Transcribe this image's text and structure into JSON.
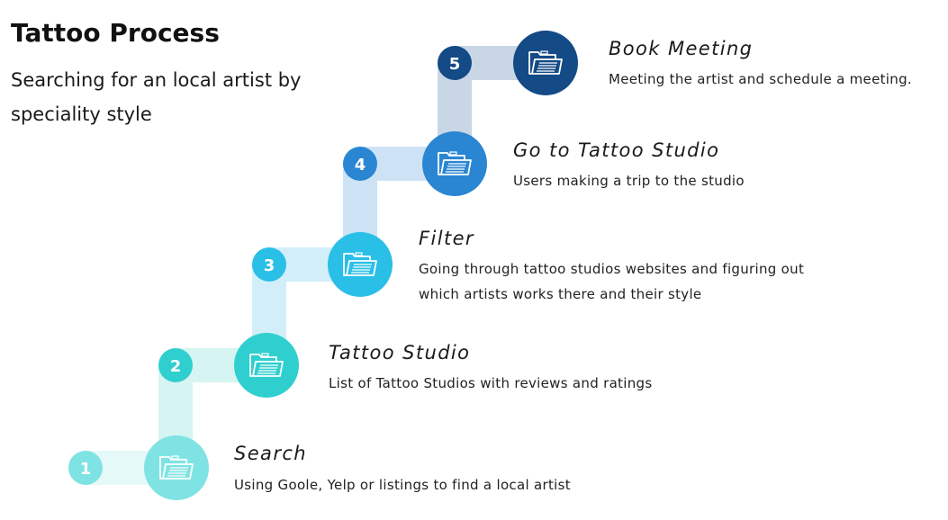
{
  "header": {
    "title": "Tattoo Process",
    "subtitle": "Searching for an local artist by speciality style"
  },
  "steps": [
    {
      "number": "1",
      "title": "Search",
      "description": "Using Goole, Yelp or listings to find  a local artist",
      "icon": "folder-icon",
      "color": "#7fe3e3",
      "track_color": "#e6f9f9"
    },
    {
      "number": "2",
      "title": "Tattoo Studio",
      "description": "List of Tattoo Studios with reviews and ratings",
      "icon": "folder-icon",
      "color": "#2fcfcf",
      "track_color": "#d6f5f2"
    },
    {
      "number": "3",
      "title": "Filter",
      "description": "Going through tattoo studios websites and figuring out which artists works there and their style",
      "icon": "folder-icon",
      "color": "#29bfe6",
      "track_color": "#d2eff9"
    },
    {
      "number": "4",
      "title": "Go to Tattoo Studio",
      "description": "Users making a trip to the studio",
      "icon": "folder-icon",
      "color": "#2a86d2",
      "track_color": "#cde3f5"
    },
    {
      "number": "5",
      "title": "Book Meeting",
      "description": "Meeting the artist and schedule a meeting.",
      "icon": "folder-icon",
      "color": "#144a85",
      "track_color": "#c8d6e6"
    }
  ]
}
